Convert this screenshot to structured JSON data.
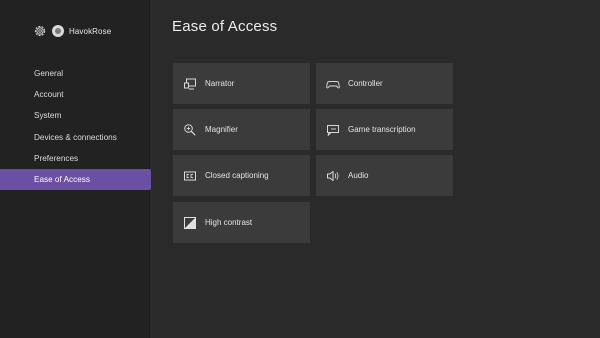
{
  "profile": {
    "gamertag": "HavokRose"
  },
  "nav": {
    "items": [
      {
        "label": "General"
      },
      {
        "label": "Account"
      },
      {
        "label": "System"
      },
      {
        "label": "Devices & connections"
      },
      {
        "label": "Preferences"
      },
      {
        "label": "Ease of Access",
        "selected": true
      }
    ]
  },
  "page": {
    "title": "Ease of Access"
  },
  "tiles": [
    {
      "label": "Narrator",
      "icon": "narrator-icon"
    },
    {
      "label": "Controller",
      "icon": "controller-icon"
    },
    {
      "label": "Magnifier",
      "icon": "magnifier-icon"
    },
    {
      "label": "Game transcription",
      "icon": "game-transcription-icon"
    },
    {
      "label": "Closed captioning",
      "icon": "closed-captioning-icon"
    },
    {
      "label": "Audio",
      "icon": "audio-icon"
    },
    {
      "label": "High contrast",
      "icon": "high-contrast-icon"
    }
  ],
  "colors": {
    "background": "#2a2a2a",
    "sidebar": "#222222",
    "accent": "#6b4fa3",
    "tile": "#3b3b3b"
  }
}
